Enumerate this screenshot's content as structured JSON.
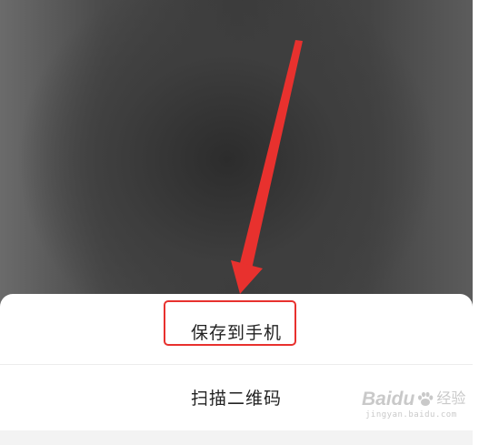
{
  "action_sheet": {
    "options": [
      {
        "label": "保存到手机",
        "highlighted": true
      },
      {
        "label": "扫描二维码",
        "highlighted": false
      }
    ]
  },
  "annotation": {
    "arrow_color": "#e8312e",
    "highlight_color": "#e8312e"
  },
  "watermark": {
    "brand": "Baidu",
    "brand_sub": "经验",
    "url": "jingyan.baidu.com",
    "icon": "paw-icon"
  }
}
